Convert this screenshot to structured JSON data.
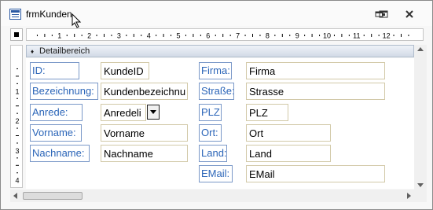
{
  "window": {
    "title": "frmKunden",
    "app_icon": "form-icon",
    "controls": [
      "minimize-icon",
      "restore-icon",
      "close-icon"
    ]
  },
  "ruler": {
    "horizontal_numbers": [
      "1",
      "2",
      "3",
      "4",
      "5",
      "6",
      "7",
      "8",
      "9",
      "10",
      "11",
      "12"
    ],
    "vertical_numbers": [
      "1",
      "2",
      "3",
      "4"
    ]
  },
  "section": {
    "collapse_icon": "section-marker-icon",
    "title": "Detailbereich"
  },
  "fields_left": [
    {
      "label": "ID:",
      "value": "KundeID"
    },
    {
      "label": "Bezeichnung:",
      "value": "Kundenbezeichnu"
    },
    {
      "label": "Anrede:",
      "value": "Anredeli"
    },
    {
      "label": "Vorname:",
      "value": "Vorname"
    },
    {
      "label": "Nachname:",
      "value": "Nachname"
    }
  ],
  "fields_right": [
    {
      "label": "Firma:",
      "value": "Firma"
    },
    {
      "label": "Straße:",
      "value": "Strasse"
    },
    {
      "label": "PLZ:",
      "value": "PLZ"
    },
    {
      "label": "Ort:",
      "value": "Ort"
    },
    {
      "label": "Land:",
      "value": "Land"
    },
    {
      "label": "EMail:",
      "value": "EMail"
    }
  ]
}
